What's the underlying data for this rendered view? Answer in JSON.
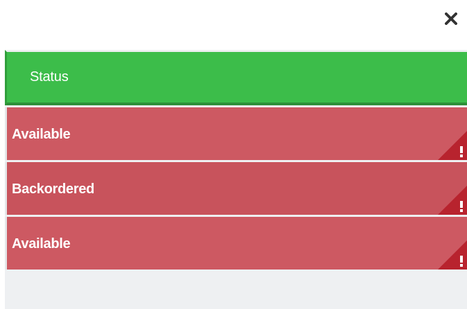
{
  "dialog": {
    "close_icon": "close-icon"
  },
  "table": {
    "header_label": "Status",
    "rows": [
      {
        "label": "Available",
        "flag_icon": "exclamation-icon"
      },
      {
        "label": "Backordered",
        "flag_icon": "exclamation-icon"
      },
      {
        "label": "Available",
        "flag_icon": "exclamation-icon"
      }
    ]
  },
  "colors": {
    "header_green": "#3cbd4a",
    "row_red": "#cd5962",
    "flag_red": "#b8232e",
    "close_grey": "#333333"
  }
}
